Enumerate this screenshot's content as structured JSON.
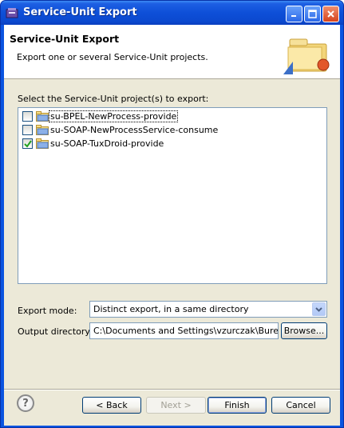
{
  "window": {
    "title": "Service-Unit Export",
    "accent": "#0a54e0"
  },
  "header": {
    "title": "Service-Unit Export",
    "description": "Export one or several Service-Unit projects."
  },
  "projects": {
    "label": "Select the Service-Unit project(s) to export:",
    "items": [
      {
        "label": "su-BPEL-NewProcess-provide",
        "checked": false
      },
      {
        "label": "su-SOAP-NewProcessService-consume",
        "checked": false
      },
      {
        "label": "su-SOAP-TuxDroid-provide",
        "checked": true
      }
    ]
  },
  "export_mode": {
    "label": "Export mode:",
    "value": "Distinct export, in a same directory"
  },
  "output_directory": {
    "label": "Output directory:",
    "value": "C:\\Documents and Settings\\vzurczak\\Bureau",
    "browse_label": "Browse..."
  },
  "footer": {
    "help_glyph": "?",
    "back_label": "< Back",
    "next_label": "Next >",
    "finish_label": "Finish",
    "cancel_label": "Cancel"
  }
}
